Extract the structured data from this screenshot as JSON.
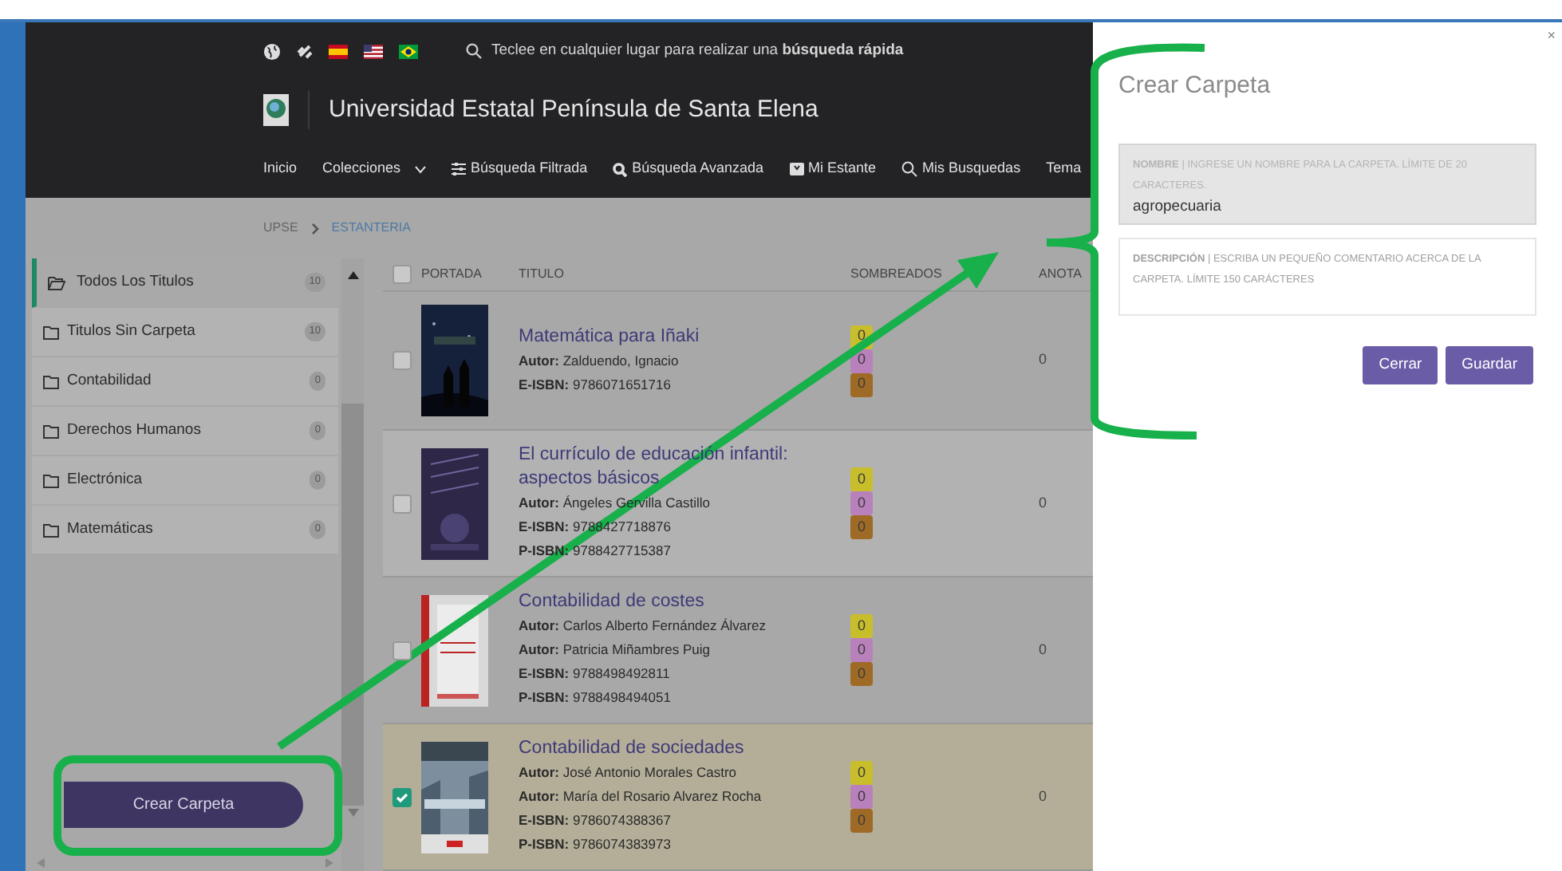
{
  "top_bar": {
    "icons": [
      {
        "kind": "globe"
      },
      {
        "kind": "link"
      },
      {
        "kind": "flag_es"
      },
      {
        "kind": "flag_us"
      },
      {
        "kind": "flag_br"
      }
    ],
    "search_hint": "Teclee en cualquier lugar para realizar una **búsqueda rápida**"
  },
  "header": {
    "title": "Universidad Estatal Península de Santa Elena"
  },
  "nav": [
    {
      "label": "Inicio",
      "kind": "plain"
    },
    {
      "label": "Colecciones",
      "kind": "dropdown"
    },
    {
      "label": "Búsqueda Filtrada",
      "kind": "filter"
    },
    {
      "label": "Búsqueda Avanzada",
      "kind": "search_bold"
    },
    {
      "label": "Mi Estante",
      "kind": "shelf"
    },
    {
      "label": "Mis Busquedas",
      "kind": "search"
    },
    {
      "label": "Tema",
      "kind": "plain"
    }
  ],
  "breadcrumb": [
    {
      "label": "UPSE",
      "selected": false
    },
    {
      "label": "ESTANTERIA",
      "selected": true
    }
  ],
  "folders": [
    {
      "label": "Todos Los Titulos",
      "count": "10",
      "selected": true
    },
    {
      "label": "Titulos Sin Carpeta",
      "count": "10",
      "selected": false
    },
    {
      "label": "Contabilidad",
      "count": "0",
      "selected": false
    },
    {
      "label": "Derechos Humanos",
      "count": "0",
      "selected": false
    },
    {
      "label": "Electrónica",
      "count": "0",
      "selected": false
    },
    {
      "label": "Matemáticas",
      "count": "0",
      "selected": false
    }
  ],
  "create_button": "Crear Carpeta",
  "table": {
    "select_all_checked": false,
    "columns": [
      "PORTADA",
      "TITULO",
      "SOMBREADOS",
      "ANOTA"
    ],
    "rows": [
      {
        "checked": false,
        "title": "Matemática para Iñaki",
        "lines": [
          {
            "label": "Autor:",
            "value": "Zalduendo, Ignacio"
          },
          {
            "label": "E-ISBN:",
            "value": "9786071651716"
          }
        ],
        "highlights": [
          {
            "count": "0",
            "color": "#c8be2c"
          },
          {
            "count": "0",
            "color": "#b981bb"
          },
          {
            "count": "0",
            "color": "#9e6a26"
          }
        ],
        "annotations": "0"
      },
      {
        "checked": false,
        "title": "El currículo de educación infantil: aspectos básicos",
        "lines": [
          {
            "label": "Autor:",
            "value": "Ángeles Gervilla Castillo"
          },
          {
            "label": "E-ISBN:",
            "value": "9788427718876"
          },
          {
            "label": "P-ISBN:",
            "value": "9788427715387"
          }
        ],
        "highlights": [
          {
            "count": "0",
            "color": "#c8be2c"
          },
          {
            "count": "0",
            "color": "#b981bb"
          },
          {
            "count": "0",
            "color": "#9e6a26"
          }
        ],
        "annotations": "0"
      },
      {
        "checked": false,
        "title": "Contabilidad de costes",
        "lines": [
          {
            "label": "Autor:",
            "value": "Carlos Alberto Fernández Álvarez"
          },
          {
            "label": "Autor:",
            "value": "Patricia Miñambres Puig"
          },
          {
            "label": "E-ISBN:",
            "value": "9788498492811"
          },
          {
            "label": "P-ISBN:",
            "value": "9788498494051"
          }
        ],
        "highlights": [
          {
            "count": "0",
            "color": "#c8be2c"
          },
          {
            "count": "0",
            "color": "#b981bb"
          },
          {
            "count": "0",
            "color": "#9e6a26"
          }
        ],
        "annotations": "0"
      },
      {
        "checked": true,
        "title": "Contabilidad de sociedades",
        "lines": [
          {
            "label": "Autor:",
            "value": "José Antonio Morales Castro"
          },
          {
            "label": "Autor:",
            "value": "María del Rosario Alvarez Rocha"
          },
          {
            "label": "E-ISBN:",
            "value": "9786074388367"
          },
          {
            "label": "P-ISBN:",
            "value": "9786074383973"
          }
        ],
        "highlights": [
          {
            "count": "0",
            "color": "#c8be2c"
          },
          {
            "count": "0",
            "color": "#b981bb"
          },
          {
            "count": "0",
            "color": "#9e6a26"
          }
        ],
        "annotations": "0"
      }
    ]
  },
  "modal": {
    "close": "×",
    "title": "Crear Carpeta",
    "name_field": {
      "placeholder": "**NOMBRE** | INGRESE UN NOMBRE PARA LA CARPETA. LÍMITE DE 20 CARACTERES.",
      "value": "agropecuaria"
    },
    "description_field": {
      "placeholder": "**DESCRIPCIÓN** | ESCRIBA UN PEQUEÑO COMENTARIO ACERCA DE LA CARPETA. LÍMITE 150 CARÁCTERES"
    },
    "buttons": [
      "Cerrar",
      "Guardar"
    ]
  }
}
